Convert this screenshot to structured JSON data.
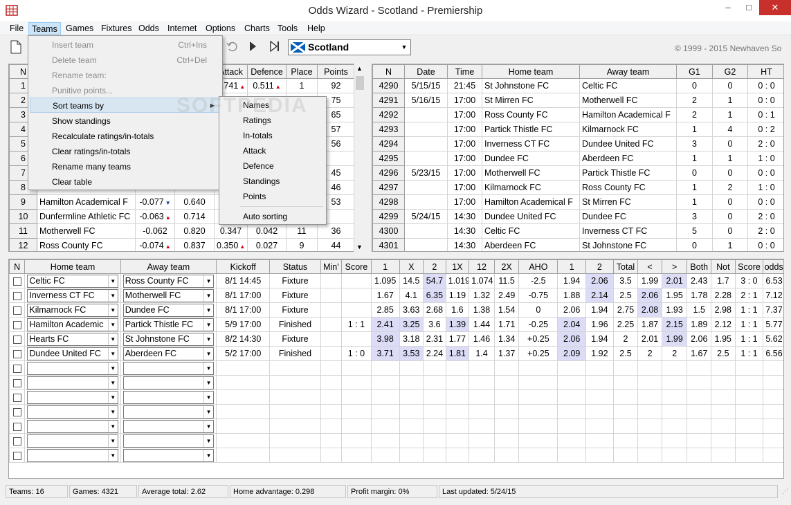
{
  "window": {
    "title": "Odds Wizard - Scotland - Premiership",
    "minimize": "–",
    "maximize": "□",
    "close": "✕"
  },
  "menubar": [
    "File",
    "Teams",
    "Games",
    "Fixtures",
    "Odds",
    "Internet",
    "Options",
    "Charts",
    "Tools",
    "Help"
  ],
  "toolbar": {
    "country": "Scotland",
    "copyright": "© 1999 - 2015 Newhaven So"
  },
  "teams_menu": {
    "items": [
      {
        "label": "Insert team",
        "shortcut": "Ctrl+Ins",
        "disabled": true
      },
      {
        "label": "Delete team",
        "shortcut": "Ctrl+Del",
        "disabled": true
      },
      {
        "label": "Rename team:",
        "shortcut": "",
        "disabled": true
      },
      {
        "label": "Punitive points...",
        "shortcut": "",
        "disabled": true
      },
      {
        "label": "Sort teams by",
        "shortcut": "",
        "disabled": false,
        "submenu": true
      },
      {
        "label": "Show standings",
        "shortcut": "",
        "disabled": false
      },
      {
        "label": "Recalculate ratings/in-totals",
        "shortcut": "",
        "disabled": false
      },
      {
        "label": "Clear ratings/in-totals",
        "shortcut": "",
        "disabled": false
      },
      {
        "label": "Rename many teams",
        "shortcut": "",
        "disabled": false
      },
      {
        "label": "Clear table",
        "shortcut": "",
        "disabled": false
      }
    ]
  },
  "sort_menu": {
    "items": [
      "Names",
      "Ratings",
      "In-totals",
      "Attack",
      "Defence",
      "Standings",
      "Points"
    ],
    "auto": "Auto sorting"
  },
  "teams_table": {
    "headers": [
      "N",
      "",
      "",
      "",
      "Attack",
      "Defence",
      "Place",
      "Points"
    ],
    "rows": [
      {
        "n": "1",
        "name": "",
        "rating": "",
        "intotal": "",
        "attack": "0.741",
        "attack_dir": "up",
        "defence": "0.511",
        "defence_dir": "up",
        "place": "1",
        "points": "92"
      },
      {
        "n": "2",
        "name": "",
        "rating": "",
        "intotal": "",
        "attack": "",
        "attack_dir": "",
        "defence": "",
        "defence_dir": "",
        "place": "",
        "points": "75"
      },
      {
        "n": "3",
        "name": "",
        "rating": "",
        "intotal": "",
        "attack": "",
        "attack_dir": "",
        "defence": "",
        "defence_dir": "",
        "place": "",
        "points": "65"
      },
      {
        "n": "4",
        "name": "",
        "rating": "",
        "intotal": "",
        "attack": "",
        "attack_dir": "",
        "defence": "",
        "defence_dir": "",
        "place": "",
        "points": "57"
      },
      {
        "n": "5",
        "name": "",
        "rating": "",
        "intotal": "",
        "attack": "",
        "attack_dir": "",
        "defence": "",
        "defence_dir": "",
        "place": "",
        "points": "56"
      },
      {
        "n": "6",
        "name": "",
        "rating": "",
        "intotal": "",
        "attack": "",
        "attack_dir": "",
        "defence": "",
        "defence_dir": "",
        "place": "",
        "points": ""
      },
      {
        "n": "7",
        "name": "",
        "rating": "",
        "intotal": "",
        "attack": "",
        "attack_dir": "",
        "defence": "",
        "defence_dir": "",
        "place": "",
        "points": "45"
      },
      {
        "n": "8",
        "name": "",
        "rating": "",
        "intotal": "",
        "attack": "",
        "attack_dir": "",
        "defence": "",
        "defence_dir": "",
        "place": "",
        "points": "46"
      },
      {
        "n": "9",
        "name": "Hamilton Academical F",
        "rating": "-0.077",
        "rating_dir": "dn",
        "intotal": "0.640",
        "attack": "",
        "attack_dir": "",
        "defence": "",
        "defence_dir": "",
        "place": "",
        "points": "53"
      },
      {
        "n": "10",
        "name": "Dunfermline Athletic FC",
        "rating": "-0.063",
        "rating_dir": "up",
        "intotal": "0.714",
        "attack": "",
        "attack_dir": "",
        "defence": "",
        "defence_dir": "",
        "place": "",
        "points": ""
      },
      {
        "n": "11",
        "name": "Motherwell FC",
        "rating": "-0.062",
        "rating_dir": "",
        "intotal": "0.820",
        "attack": "0.347",
        "attack_dir": "",
        "defence": "0.042",
        "defence_dir": "",
        "place": "11",
        "points": "36"
      },
      {
        "n": "12",
        "name": "Ross County FC",
        "rating": "-0.074",
        "rating_dir": "up",
        "intotal": "0.837",
        "attack": "0.350",
        "attack_dir": "up",
        "defence": "0.027",
        "defence_dir": "",
        "place": "9",
        "points": "44"
      }
    ]
  },
  "games_table": {
    "headers": [
      "N",
      "Date",
      "Time",
      "Home team",
      "Away team",
      "G1",
      "G2",
      "HT"
    ],
    "rows": [
      [
        "4290",
        "5/15/15",
        "21:45",
        "St Johnstone FC",
        "Celtic FC",
        "0",
        "0",
        "0 : 0"
      ],
      [
        "4291",
        "5/16/15",
        "17:00",
        "St Mirren FC",
        "Motherwell FC",
        "2",
        "1",
        "0 : 0"
      ],
      [
        "4292",
        "",
        "17:00",
        "Ross County FC",
        "Hamilton Academical F",
        "2",
        "1",
        "0 : 1"
      ],
      [
        "4293",
        "",
        "17:00",
        "Partick Thistle FC",
        "Kilmarnock FC",
        "1",
        "4",
        "0 : 2"
      ],
      [
        "4294",
        "",
        "17:00",
        "Inverness CT FC",
        "Dundee United FC",
        "3",
        "0",
        "2 : 0"
      ],
      [
        "4295",
        "",
        "17:00",
        "Dundee FC",
        "Aberdeen FC",
        "1",
        "1",
        "1 : 0"
      ],
      [
        "4296",
        "5/23/15",
        "17:00",
        "Motherwell FC",
        "Partick Thistle FC",
        "0",
        "0",
        "0 : 0"
      ],
      [
        "4297",
        "",
        "17:00",
        "Kilmarnock FC",
        "Ross County FC",
        "1",
        "2",
        "1 : 0"
      ],
      [
        "4298",
        "",
        "17:00",
        "Hamilton Academical F",
        "St Mirren FC",
        "1",
        "0",
        "0 : 0"
      ],
      [
        "4299",
        "5/24/15",
        "14:30",
        "Dundee United FC",
        "Dundee FC",
        "3",
        "0",
        "2 : 0"
      ],
      [
        "4300",
        "",
        "14:30",
        "Celtic FC",
        "Inverness CT FC",
        "5",
        "0",
        "2 : 0"
      ],
      [
        "4301",
        "",
        "14:30",
        "Aberdeen FC",
        "St Johnstone FC",
        "0",
        "1",
        "0 : 0"
      ]
    ]
  },
  "fixtures_table": {
    "headers": [
      "N",
      "Home team",
      "Away team",
      "Kickoff",
      "Status",
      "Min'",
      "Score",
      "1",
      "X",
      "2",
      "1X",
      "12",
      "2X",
      "AHO",
      "1",
      "2",
      "Total",
      "<",
      ">",
      "Both",
      "Not",
      "Score",
      "odds"
    ],
    "rows": [
      {
        "home": "Celtic FC",
        "away": "Ross County FC",
        "kickoff": "8/1 14:45",
        "status": "Fixture",
        "min": "",
        "score": "",
        "v": [
          "1.095",
          "14.5",
          "54.7",
          "1.019",
          "1.074",
          "11.5",
          "-2.5",
          "1.94",
          "2.06",
          "3.5",
          "1.99",
          "2.01",
          "2.43",
          "1.7",
          "3 : 0",
          "6.53"
        ],
        "hl": [
          2,
          8,
          11
        ]
      },
      {
        "home": "Inverness CT FC",
        "away": "Motherwell FC",
        "kickoff": "8/1 17:00",
        "status": "Fixture",
        "min": "",
        "score": "",
        "v": [
          "1.67",
          "4.1",
          "6.35",
          "1.19",
          "1.32",
          "2.49",
          "-0.75",
          "1.88",
          "2.14",
          "2.5",
          "2.06",
          "1.95",
          "1.78",
          "2.28",
          "2 : 1",
          "7.12"
        ],
        "hl": [
          2,
          8,
          10
        ]
      },
      {
        "home": "Kilmarnock FC",
        "away": "Dundee FC",
        "kickoff": "8/1 17:00",
        "status": "Fixture",
        "min": "",
        "score": "",
        "v": [
          "2.85",
          "3.63",
          "2.68",
          "1.6",
          "1.38",
          "1.54",
          "0",
          "2.06",
          "1.94",
          "2.75",
          "2.08",
          "1.93",
          "1.5",
          "2.98",
          "1 : 1",
          "7.37"
        ],
        "hl": [
          10
        ]
      },
      {
        "home": "Hamilton Academic",
        "away": "Partick Thistle FC",
        "kickoff": "5/9 17:00",
        "status": "Finished",
        "min": "",
        "score": "1 : 1",
        "v": [
          "2.41",
          "3.25",
          "3.6",
          "1.39",
          "1.44",
          "1.71",
          "-0.25",
          "2.04",
          "1.96",
          "2.25",
          "1.87",
          "2.15",
          "1.89",
          "2.12",
          "1 : 1",
          "5.77"
        ],
        "hl": [
          0,
          1,
          3,
          7,
          11
        ]
      },
      {
        "home": "Hearts FC",
        "away": "St Johnstone FC",
        "kickoff": "8/2 14:30",
        "status": "Fixture",
        "min": "",
        "score": "",
        "v": [
          "3.98",
          "3.18",
          "2.31",
          "1.77",
          "1.46",
          "1.34",
          "+0.25",
          "2.06",
          "1.94",
          "2",
          "2.01",
          "1.99",
          "2.06",
          "1.95",
          "1 : 1",
          "5.62"
        ],
        "hl": [
          0,
          7,
          11
        ]
      },
      {
        "home": "Dundee United FC",
        "away": "Aberdeen FC",
        "kickoff": "5/2 17:00",
        "status": "Finished",
        "min": "",
        "score": "1 : 0",
        "v": [
          "3.71",
          "3.53",
          "2.24",
          "1.81",
          "1.4",
          "1.37",
          "+0.25",
          "2.09",
          "1.92",
          "2.5",
          "2",
          "2",
          "1.67",
          "2.5",
          "1 : 1",
          "6.56"
        ],
        "hl": [
          0,
          1,
          3,
          7
        ]
      }
    ],
    "empty_rows": 7
  },
  "statusbar": {
    "teams": "Teams: 16",
    "games": "Games: 4321",
    "avg_total": "Average total: 2.62",
    "home_adv": "Home advantage: 0.298",
    "profit": "Profit margin: 0%",
    "updated": "Last updated: 5/24/15"
  },
  "watermark": "SOFTPEDIA"
}
